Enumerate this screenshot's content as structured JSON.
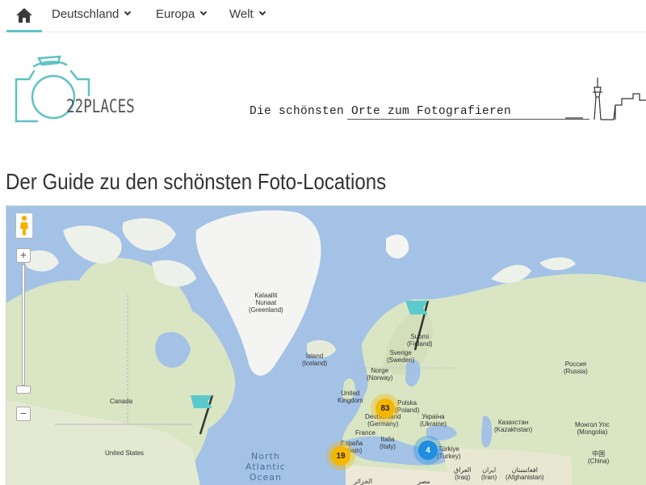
{
  "nav": {
    "home_icon": "home-icon",
    "items": [
      {
        "label": "Deutschland"
      },
      {
        "label": "Europa"
      },
      {
        "label": "Welt"
      }
    ]
  },
  "header": {
    "logo_text": "22PLACES",
    "tagline": "Die schönsten Orte zum Fotografieren"
  },
  "page_title": "Der Guide zu den schönsten Foto-Locations",
  "map": {
    "zoom_in": "+",
    "zoom_out": "−",
    "labels": {
      "greenland": [
        "Kalaallit",
        "Nunaat",
        "(Greenland)"
      ],
      "iceland": [
        "Ísland",
        "(Iceland)"
      ],
      "finland": [
        "Suomi",
        "(Finland)"
      ],
      "sweden": [
        "Sverige",
        "(Sweden)"
      ],
      "norway": [
        "Norge",
        "(Norway)"
      ],
      "uk": [
        "United",
        "Kingdom"
      ],
      "poland": [
        "Polska",
        "(Poland)"
      ],
      "germany": [
        "Deutschland",
        "(Germany)"
      ],
      "ukraine": [
        "Україна",
        "(Ukraine)"
      ],
      "france": [
        "France"
      ],
      "italy": [
        "Italia",
        "(Italy)"
      ],
      "spain": [
        "España",
        "(Spain)"
      ],
      "turkey": [
        "Türkiye",
        "(Turkey)"
      ],
      "iraq": [
        "العراق",
        "(Iraq)"
      ],
      "iran": [
        "ایران",
        "(Iran)"
      ],
      "egypt": [
        "مصر"
      ],
      "algeria": [
        "الجزائر"
      ],
      "afghanistan": [
        "افغانستان",
        "(Afghanistan)"
      ],
      "canada": [
        "Canada"
      ],
      "usa": [
        "United States"
      ],
      "russia": [
        "Россия",
        "(Russia)"
      ],
      "kazakhstan": [
        "Казахстан",
        "(Kazakhstan)"
      ],
      "mongolia": [
        "Монгол Улс",
        "(Mongolia)"
      ],
      "china": [
        "中国",
        "(China)"
      ],
      "ocean": [
        "North",
        "Atlantic",
        "Ocean"
      ]
    },
    "clusters": [
      {
        "count": "83",
        "color": "#f7b600"
      },
      {
        "count": "19",
        "color": "#f7b600"
      },
      {
        "count": "4",
        "color": "#1f8de0"
      }
    ],
    "colors": {
      "water": "#a3c2e6",
      "land": "#d9e5c3",
      "ice": "#f4f4f2",
      "flag": "#5cc9cc"
    }
  }
}
